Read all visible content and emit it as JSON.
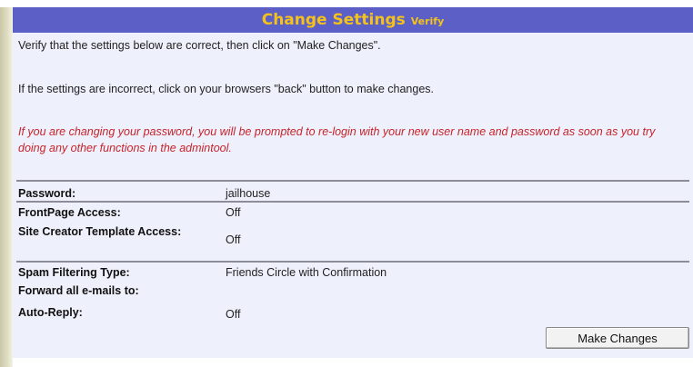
{
  "header": {
    "title": "Change Settings",
    "subtitle": "Verify"
  },
  "messages": {
    "verify": "Verify that the settings below are correct, then click on \"Make Changes\".",
    "incorrect": "If the settings are incorrect, click on your browsers \"back\" button to make changes.",
    "password_note": "If you are changing your password, you will be prompted to re-login with your new user name and password as soon as you try doing any other functions in the admintool."
  },
  "settings": [
    {
      "label": "Password:",
      "value": "jailhouse"
    },
    {
      "label": "FrontPage Access:",
      "value": "Off"
    },
    {
      "label": "Site Creator Template Access:",
      "value": "Off"
    },
    {
      "label": "Spam Filtering Type:",
      "value": "Friends Circle with Confirmation"
    },
    {
      "label": "Forward all e-mails to:",
      "value": ""
    },
    {
      "label": "Auto-Reply:",
      "value": "Off"
    }
  ],
  "actions": {
    "make_changes_label": "Make Changes"
  },
  "colors": {
    "title_bar": "#5b5fc6",
    "title_text": "#f4c21a",
    "panel_bg": "#eef0fb",
    "warning_text": "#c8232a"
  }
}
